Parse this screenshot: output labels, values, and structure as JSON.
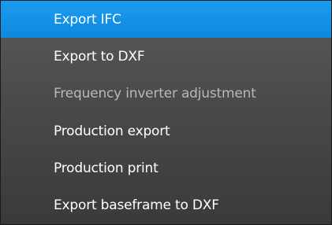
{
  "menu": {
    "items": [
      {
        "label": "Export IFC",
        "state": "highlighted"
      },
      {
        "label": "Export to DXF",
        "state": "normal"
      },
      {
        "label": "Frequency inverter adjustment",
        "state": "disabled"
      },
      {
        "label": "Production export",
        "state": "normal"
      },
      {
        "label": "Production print",
        "state": "normal"
      },
      {
        "label": "Export baseframe to DXF",
        "state": "normal"
      }
    ]
  },
  "colors": {
    "highlight": "#0e88e0",
    "menu_background": "#4a4a4a",
    "text": "#ffffff",
    "disabled_text": "#b8b8b8"
  }
}
